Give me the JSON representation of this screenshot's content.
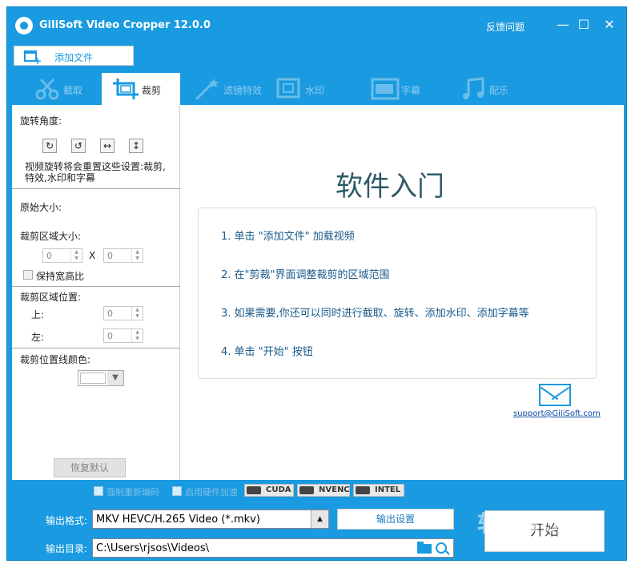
{
  "window": {
    "title": "GiliSoft Video Cropper 12.0.0",
    "feedback": "反馈问题",
    "minimize": "—",
    "maximize": "☐",
    "close": "✕"
  },
  "toolbar": {
    "add_file": "添加文件"
  },
  "tabs": [
    {
      "label": "截取",
      "icon": "cut-icon",
      "active": false
    },
    {
      "label": "裁剪",
      "icon": "crop-icon",
      "active": true
    },
    {
      "label": "滤镜特效",
      "icon": "magic-wand-icon",
      "active": false
    },
    {
      "label": "水印",
      "icon": "watermark-icon",
      "active": false
    },
    {
      "label": "字幕",
      "icon": "subtitle-icon",
      "active": false
    },
    {
      "label": "配乐",
      "icon": "music-icon",
      "active": false
    }
  ],
  "left": {
    "rotation_label": "旋转角度:",
    "rotate_buttons": [
      "↻",
      "↺",
      "↔",
      "↕"
    ],
    "rotation_note": "视频旋转将会重置这些设置:裁剪, 特效,水印和字幕",
    "original_size_label": "原始大小:",
    "crop_size_label": "裁剪区域大小:",
    "crop_width": "0",
    "crop_x_sep": "X",
    "crop_height": "0",
    "keep_ratio_label": "保持宽高比",
    "crop_pos_label": "裁剪区域位置:",
    "top_label": "上:",
    "top_value": "0",
    "left_label": "左:",
    "left_value": "0",
    "line_color_label": "裁剪位置线颜色:",
    "line_color": "#ffffff",
    "reset_button": "恢复默认"
  },
  "main": {
    "heading": "软件入门",
    "steps": [
      "1. 单击 \"添加文件\" 加载视频",
      "2. 在\"剪裁\"界面调整裁剪的区域范围",
      "3. 如果需要,你还可以同时进行截取、旋转、添加水印、添加字幕等",
      "4. 单击 \"开始\" 按钮"
    ],
    "support_email": "support@GiliSoft.com"
  },
  "bottom": {
    "force_reencode": "强制重新编码",
    "hw_accel": "启用硬件加速",
    "accel_options": [
      "CUDA",
      "NVENC",
      "INTEL"
    ],
    "format_label": "输出格式:",
    "format_value": "MKV HEVC/H.265 Video (*.mkv)",
    "output_settings": "输出设置",
    "dir_label": "输出目录:",
    "dir_value": "C:\\Users\\rjsos\\Videos\\",
    "start_button": "开始"
  },
  "watermark_text": "软件SOS",
  "colors": {
    "accent": "#1a9ae0",
    "link": "#0b4aa8"
  }
}
